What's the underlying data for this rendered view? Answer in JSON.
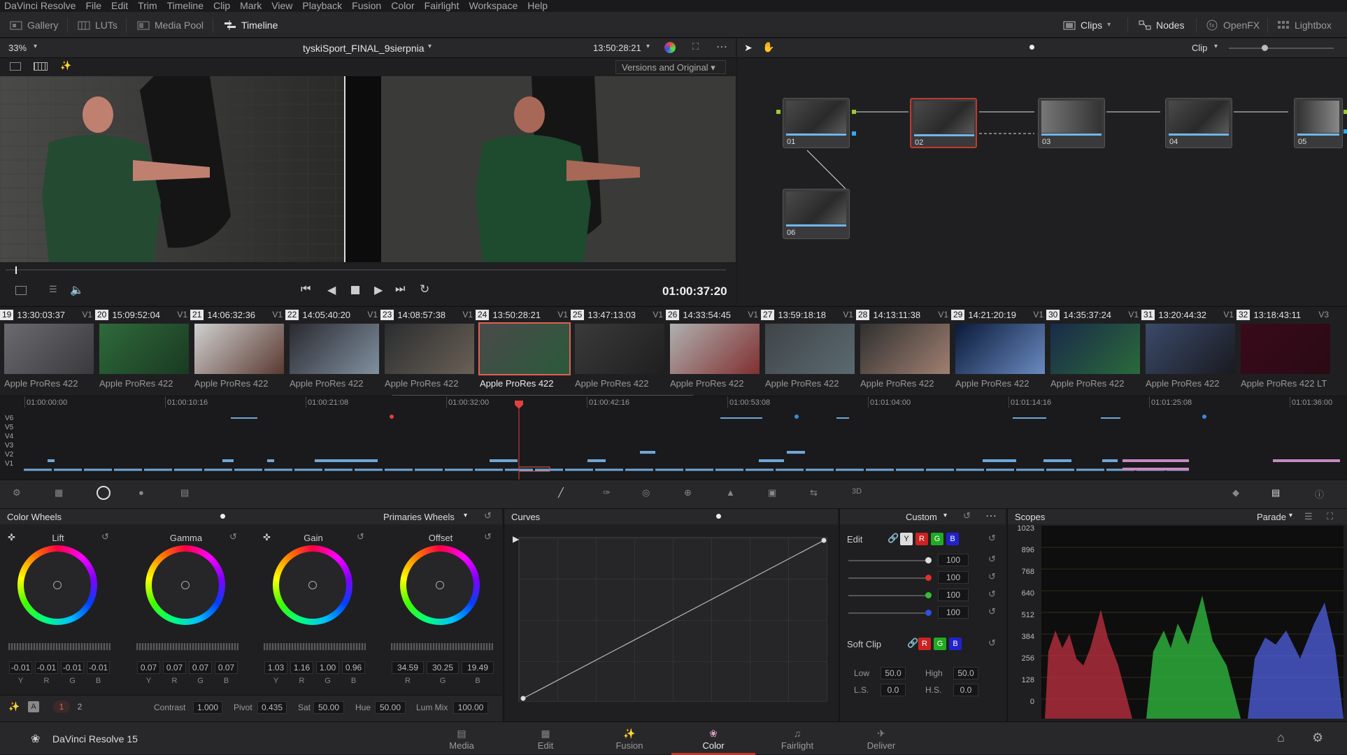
{
  "menubar": [
    "DaVinci Resolve",
    "File",
    "Edit",
    "Trim",
    "Timeline",
    "Clip",
    "Mark",
    "View",
    "Playback",
    "Fusion",
    "Color",
    "Fairlight",
    "Workspace",
    "Help"
  ],
  "toolbar": {
    "gallery": "Gallery",
    "luts": "LUTs",
    "media_pool": "Media Pool",
    "timeline": "Timeline",
    "clips": "Clips",
    "nodes": "Nodes",
    "openfx": "OpenFX",
    "lightbox": "Lightbox"
  },
  "viewer": {
    "zoom": "33%",
    "title": "tyskiSport_FINAL_9sierpnia",
    "timecode": "13:50:28:21",
    "versions": "Versions and Original",
    "playhead_tc": "01:00:37:20"
  },
  "nodes_panel": {
    "mode": "Clip",
    "nodes": [
      "01",
      "02",
      "03",
      "04",
      "05",
      "06"
    ]
  },
  "clips": [
    {
      "num": "19",
      "tc": "13:30:03:37",
      "track": "V1",
      "codec": "Apple ProRes 422",
      "colors": [
        "#6a6a70",
        "#3a3a3d"
      ]
    },
    {
      "num": "20",
      "tc": "15:09:52:04",
      "track": "V1",
      "codec": "Apple ProRes 422",
      "colors": [
        "#2e6a3a",
        "#1a3a22"
      ]
    },
    {
      "num": "21",
      "tc": "14:06:32:36",
      "track": "V1",
      "codec": "Apple ProRes 422",
      "colors": [
        "#d0d0d0",
        "#5a3a30"
      ]
    },
    {
      "num": "22",
      "tc": "14:05:40:20",
      "track": "V1",
      "codec": "Apple ProRes 422",
      "colors": [
        "#2a2a30",
        "#8090a0"
      ]
    },
    {
      "num": "23",
      "tc": "14:08:57:38",
      "track": "V1",
      "codec": "Apple ProRes 422",
      "colors": [
        "#2a2d30",
        "#6a6055"
      ]
    },
    {
      "num": "24",
      "tc": "13:50:28:21",
      "track": "V1",
      "codec": "Apple ProRes 422",
      "colors": [
        "#4a4a4a",
        "#2a5a3a"
      ]
    },
    {
      "num": "25",
      "tc": "13:47:13:03",
      "track": "V1",
      "codec": "Apple ProRes 422",
      "colors": [
        "#3a3a3a",
        "#1f1f1f"
      ]
    },
    {
      "num": "26",
      "tc": "14:33:54:45",
      "track": "V1",
      "codec": "Apple ProRes 422",
      "colors": [
        "#b0b0b0",
        "#803030"
      ]
    },
    {
      "num": "27",
      "tc": "13:59:18:18",
      "track": "V1",
      "codec": "Apple ProRes 422",
      "colors": [
        "#404448",
        "#5a6a70"
      ]
    },
    {
      "num": "28",
      "tc": "14:13:11:38",
      "track": "V1",
      "codec": "Apple ProRes 422",
      "colors": [
        "#303030",
        "#a08070"
      ]
    },
    {
      "num": "29",
      "tc": "14:21:20:19",
      "track": "V1",
      "codec": "Apple ProRes 422",
      "colors": [
        "#0a1a3a",
        "#6a8ac0"
      ]
    },
    {
      "num": "30",
      "tc": "14:35:37:24",
      "track": "V1",
      "codec": "Apple ProRes 422",
      "colors": [
        "#1a2a4a",
        "#2a6a3a"
      ]
    },
    {
      "num": "31",
      "tc": "13:20:44:32",
      "track": "V1",
      "codec": "Apple ProRes 422",
      "colors": [
        "#3a4a6a",
        "#1a1a20"
      ]
    },
    {
      "num": "32",
      "tc": "13:18:43:11",
      "track": "V3",
      "codec": "Apple ProRes 422 LT",
      "colors": [
        "#3a0a1a",
        "#2a0a14"
      ]
    }
  ],
  "timeline": {
    "ruler": [
      "01:00:00:00",
      "01:00:10:16",
      "01:00:21:08",
      "01:00:32:00",
      "01:00:42:16",
      "01:00:53:08",
      "01:01:04:00",
      "01:01:14:16",
      "01:01:25:08",
      "01:01:36:00"
    ],
    "tracks": [
      "V6",
      "V5",
      "V4",
      "V3",
      "V2",
      "V1"
    ]
  },
  "color_wheels": {
    "title": "Color Wheels",
    "mode": "Primaries Wheels",
    "wheels": [
      {
        "name": "Lift",
        "values": [
          "-0.01",
          "-0.01",
          "-0.01",
          "-0.01"
        ],
        "labels": [
          "Y",
          "R",
          "G",
          "B"
        ]
      },
      {
        "name": "Gamma",
        "values": [
          "0.07",
          "0.07",
          "0.07",
          "0.07"
        ],
        "labels": [
          "Y",
          "R",
          "G",
          "B"
        ]
      },
      {
        "name": "Gain",
        "values": [
          "1.03",
          "1.16",
          "1.00",
          "0.96"
        ],
        "labels": [
          "Y",
          "R",
          "G",
          "B"
        ]
      },
      {
        "name": "Offset",
        "values": [
          "34.59",
          "30.25",
          "19.49"
        ],
        "labels": [
          "R",
          "G",
          "B"
        ]
      }
    ],
    "pages": [
      "1",
      "2"
    ],
    "params": {
      "contrast_label": "Contrast",
      "contrast": "1.000",
      "pivot_label": "Pivot",
      "pivot": "0.435",
      "sat_label": "Sat",
      "sat": "50.00",
      "hue_label": "Hue",
      "hue": "50.00",
      "lummix_label": "Lum Mix",
      "lummix": "100.00"
    }
  },
  "curves": {
    "title": "Curves",
    "mode": "Custom",
    "edit_label": "Edit",
    "channels": [
      "Y",
      "R",
      "G",
      "B"
    ],
    "values": [
      "100",
      "100",
      "100",
      "100"
    ],
    "softclip_label": "Soft Clip",
    "low_label": "Low",
    "low": "50.0",
    "high_label": "High",
    "high": "50.0",
    "ls_label": "L.S.",
    "ls": "0.0",
    "hs_label": "H.S.",
    "hs": "0.0"
  },
  "scopes": {
    "title": "Scopes",
    "mode": "Parade",
    "ticks": [
      "1023",
      "896",
      "768",
      "640",
      "512",
      "384",
      "256",
      "128",
      "0"
    ]
  },
  "footer": {
    "app": "DaVinci Resolve 15",
    "pages": [
      "Media",
      "Edit",
      "Fusion",
      "Color",
      "Fairlight",
      "Deliver"
    ],
    "active": "Color"
  }
}
